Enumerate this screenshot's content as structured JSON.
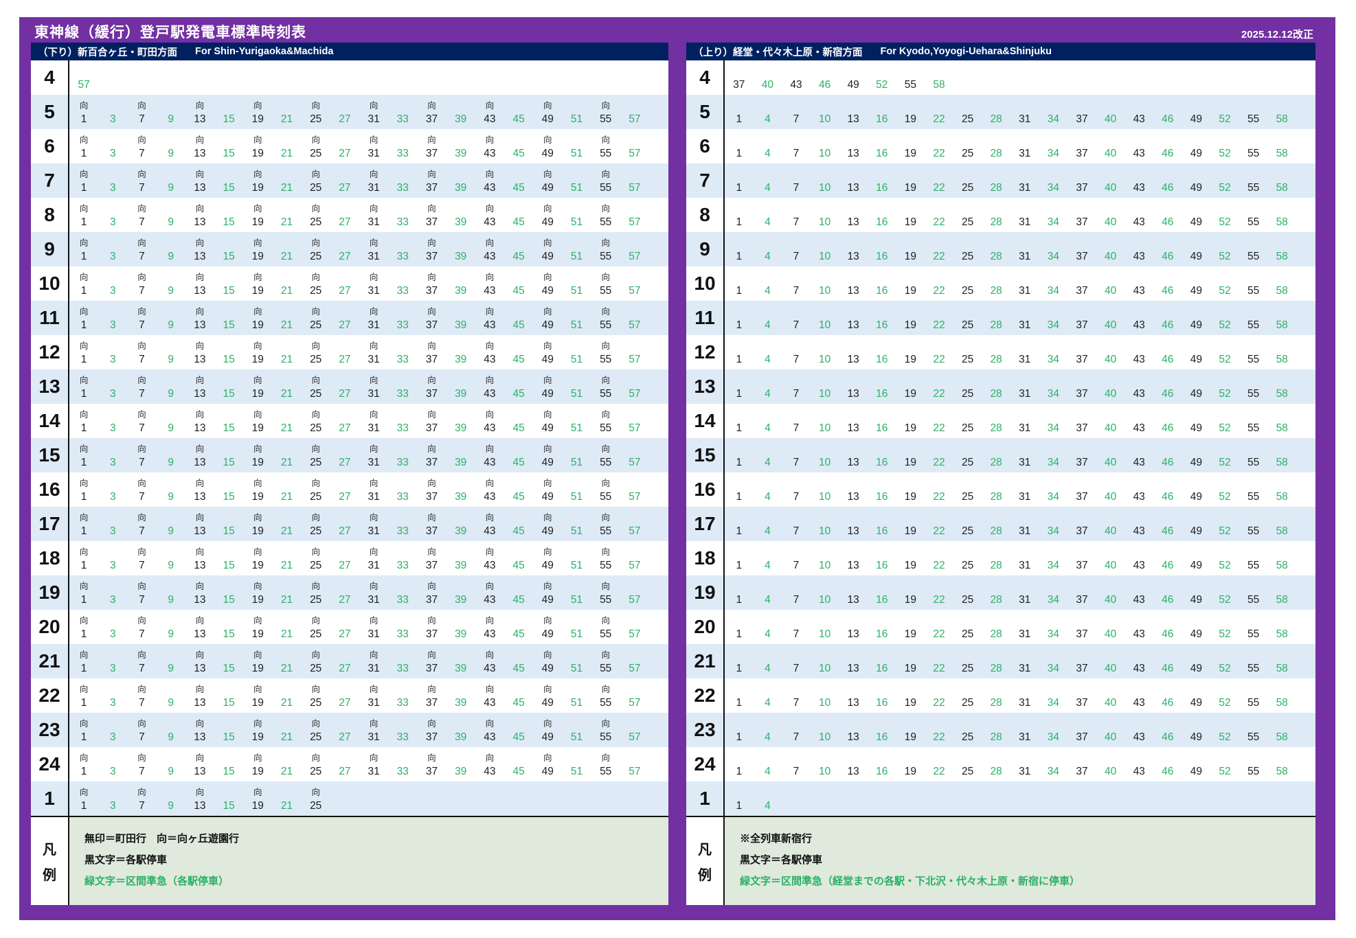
{
  "title": "東神線（緩行）登戸駅発電車標準時刻表",
  "revision": "2025.12.12改正",
  "colors": {
    "accent_purple": "#7230A3",
    "header_navy": "#002060",
    "row_alt_blue": "#DEEAF6",
    "legend_bg_green": "#DFE9DC",
    "semi_express_green": "#2BB166"
  },
  "marker_glyph": "向",
  "panels": [
    {
      "name": "down",
      "header_jp": "（下り）新百合ヶ丘・町田方面",
      "header_en": "For Shin-Yurigaoka&Machida",
      "legend_title": "凡例",
      "legend_lines": [
        {
          "text": "無印＝町田行　向＝向ヶ丘遊園行",
          "green": false
        },
        {
          "text": "黒文字＝各駅停車",
          "green": false
        },
        {
          "text": "緑文字＝区間準急（各駅停車）",
          "green": true
        }
      ],
      "rows": [
        {
          "hour": "4",
          "minutes": [
            "57g"
          ]
        },
        {
          "hour": "5",
          "minutes": [
            "1v",
            "3g",
            "7v",
            "9g",
            "13v",
            "15g",
            "19v",
            "21g",
            "25v",
            "27g",
            "31v",
            "33g",
            "37v",
            "39g",
            "43v",
            "45g",
            "49v",
            "51g",
            "55v",
            "57g"
          ]
        },
        {
          "hour": "6",
          "minutes": [
            "1v",
            "3g",
            "7v",
            "9g",
            "13v",
            "15g",
            "19v",
            "21g",
            "25v",
            "27g",
            "31v",
            "33g",
            "37v",
            "39g",
            "43v",
            "45g",
            "49v",
            "51g",
            "55v",
            "57g"
          ]
        },
        {
          "hour": "7",
          "minutes": [
            "1v",
            "3g",
            "7v",
            "9g",
            "13v",
            "15g",
            "19v",
            "21g",
            "25v",
            "27g",
            "31v",
            "33g",
            "37v",
            "39g",
            "43v",
            "45g",
            "49v",
            "51g",
            "55v",
            "57g"
          ]
        },
        {
          "hour": "8",
          "minutes": [
            "1v",
            "3g",
            "7v",
            "9g",
            "13v",
            "15g",
            "19v",
            "21g",
            "25v",
            "27g",
            "31v",
            "33g",
            "37v",
            "39g",
            "43v",
            "45g",
            "49v",
            "51g",
            "55v",
            "57g"
          ]
        },
        {
          "hour": "9",
          "minutes": [
            "1v",
            "3g",
            "7v",
            "9g",
            "13v",
            "15g",
            "19v",
            "21g",
            "25v",
            "27g",
            "31v",
            "33g",
            "37v",
            "39g",
            "43v",
            "45g",
            "49v",
            "51g",
            "55v",
            "57g"
          ]
        },
        {
          "hour": "10",
          "minutes": [
            "1v",
            "3g",
            "7v",
            "9g",
            "13v",
            "15g",
            "19v",
            "21g",
            "25v",
            "27g",
            "31v",
            "33g",
            "37v",
            "39g",
            "43v",
            "45g",
            "49v",
            "51g",
            "55v",
            "57g"
          ]
        },
        {
          "hour": "11",
          "minutes": [
            "1v",
            "3g",
            "7v",
            "9g",
            "13v",
            "15g",
            "19v",
            "21g",
            "25v",
            "27g",
            "31v",
            "33g",
            "37v",
            "39g",
            "43v",
            "45g",
            "49v",
            "51g",
            "55v",
            "57g"
          ]
        },
        {
          "hour": "12",
          "minutes": [
            "1v",
            "3g",
            "7v",
            "9g",
            "13v",
            "15g",
            "19v",
            "21g",
            "25v",
            "27g",
            "31v",
            "33g",
            "37v",
            "39g",
            "43v",
            "45g",
            "49v",
            "51g",
            "55v",
            "57g"
          ]
        },
        {
          "hour": "13",
          "minutes": [
            "1v",
            "3g",
            "7v",
            "9g",
            "13v",
            "15g",
            "19v",
            "21g",
            "25v",
            "27g",
            "31v",
            "33g",
            "37v",
            "39g",
            "43v",
            "45g",
            "49v",
            "51g",
            "55v",
            "57g"
          ]
        },
        {
          "hour": "14",
          "minutes": [
            "1v",
            "3g",
            "7v",
            "9g",
            "13v",
            "15g",
            "19v",
            "21g",
            "25v",
            "27g",
            "31v",
            "33g",
            "37v",
            "39g",
            "43v",
            "45g",
            "49v",
            "51g",
            "55v",
            "57g"
          ]
        },
        {
          "hour": "15",
          "minutes": [
            "1v",
            "3g",
            "7v",
            "9g",
            "13v",
            "15g",
            "19v",
            "21g",
            "25v",
            "27g",
            "31v",
            "33g",
            "37v",
            "39g",
            "43v",
            "45g",
            "49v",
            "51g",
            "55v",
            "57g"
          ]
        },
        {
          "hour": "16",
          "minutes": [
            "1v",
            "3g",
            "7v",
            "9g",
            "13v",
            "15g",
            "19v",
            "21g",
            "25v",
            "27g",
            "31v",
            "33g",
            "37v",
            "39g",
            "43v",
            "45g",
            "49v",
            "51g",
            "55v",
            "57g"
          ]
        },
        {
          "hour": "17",
          "minutes": [
            "1v",
            "3g",
            "7v",
            "9g",
            "13v",
            "15g",
            "19v",
            "21g",
            "25v",
            "27g",
            "31v",
            "33g",
            "37v",
            "39g",
            "43v",
            "45g",
            "49v",
            "51g",
            "55v",
            "57g"
          ]
        },
        {
          "hour": "18",
          "minutes": [
            "1v",
            "3g",
            "7v",
            "9g",
            "13v",
            "15g",
            "19v",
            "21g",
            "25v",
            "27g",
            "31v",
            "33g",
            "37v",
            "39g",
            "43v",
            "45g",
            "49v",
            "51g",
            "55v",
            "57g"
          ]
        },
        {
          "hour": "19",
          "minutes": [
            "1v",
            "3g",
            "7v",
            "9g",
            "13v",
            "15g",
            "19v",
            "21g",
            "25v",
            "27g",
            "31v",
            "33g",
            "37v",
            "39g",
            "43v",
            "45g",
            "49v",
            "51g",
            "55v",
            "57g"
          ]
        },
        {
          "hour": "20",
          "minutes": [
            "1v",
            "3g",
            "7v",
            "9g",
            "13v",
            "15g",
            "19v",
            "21g",
            "25v",
            "27g",
            "31v",
            "33g",
            "37v",
            "39g",
            "43v",
            "45g",
            "49v",
            "51g",
            "55v",
            "57g"
          ]
        },
        {
          "hour": "21",
          "minutes": [
            "1v",
            "3g",
            "7v",
            "9g",
            "13v",
            "15g",
            "19v",
            "21g",
            "25v",
            "27g",
            "31v",
            "33g",
            "37v",
            "39g",
            "43v",
            "45g",
            "49v",
            "51g",
            "55v",
            "57g"
          ]
        },
        {
          "hour": "22",
          "minutes": [
            "1v",
            "3g",
            "7v",
            "9g",
            "13v",
            "15g",
            "19v",
            "21g",
            "25v",
            "27g",
            "31v",
            "33g",
            "37v",
            "39g",
            "43v",
            "45g",
            "49v",
            "51g",
            "55v",
            "57g"
          ]
        },
        {
          "hour": "23",
          "minutes": [
            "1v",
            "3g",
            "7v",
            "9g",
            "13v",
            "15g",
            "19v",
            "21g",
            "25v",
            "27g",
            "31v",
            "33g",
            "37v",
            "39g",
            "43v",
            "45g",
            "49v",
            "51g",
            "55v",
            "57g"
          ]
        },
        {
          "hour": "24",
          "minutes": [
            "1v",
            "3g",
            "7v",
            "9g",
            "13v",
            "15g",
            "19v",
            "21g",
            "25v",
            "27g",
            "31v",
            "33g",
            "37v",
            "39g",
            "43v",
            "45g",
            "49v",
            "51g",
            "55v",
            "57g"
          ]
        },
        {
          "hour": "1",
          "minutes": [
            "1v",
            "3g",
            "7v",
            "9g",
            "13v",
            "15g",
            "19v",
            "21g",
            "25v"
          ]
        }
      ]
    },
    {
      "name": "up",
      "header_jp": "（上り）経堂・代々木上原・新宿方面",
      "header_en": "For Kyodo,Yoyogi-Uehara&Shinjuku",
      "legend_title": "凡例",
      "legend_lines": [
        {
          "text": "※全列車新宿行",
          "green": false
        },
        {
          "text": "黒文字＝各駅停車",
          "green": false
        },
        {
          "text": "緑文字＝区間準急（経堂までの各駅・下北沢・代々木上原・新宿に停車）",
          "green": true
        }
      ],
      "rows": [
        {
          "hour": "4",
          "minutes": [
            "37",
            "40g",
            "43",
            "46g",
            "49",
            "52g",
            "55",
            "58g"
          ]
        },
        {
          "hour": "5",
          "minutes": [
            "1",
            "4g",
            "7",
            "10g",
            "13",
            "16g",
            "19",
            "22g",
            "25",
            "28g",
            "31",
            "34g",
            "37",
            "40g",
            "43",
            "46g",
            "49",
            "52g",
            "55",
            "58g"
          ]
        },
        {
          "hour": "6",
          "minutes": [
            "1",
            "4g",
            "7",
            "10g",
            "13",
            "16g",
            "19",
            "22g",
            "25",
            "28g",
            "31",
            "34g",
            "37",
            "40g",
            "43",
            "46g",
            "49",
            "52g",
            "55",
            "58g"
          ]
        },
        {
          "hour": "7",
          "minutes": [
            "1",
            "4g",
            "7",
            "10g",
            "13",
            "16g",
            "19",
            "22g",
            "25",
            "28g",
            "31",
            "34g",
            "37",
            "40g",
            "43",
            "46g",
            "49",
            "52g",
            "55",
            "58g"
          ]
        },
        {
          "hour": "8",
          "minutes": [
            "1",
            "4g",
            "7",
            "10g",
            "13",
            "16g",
            "19",
            "22g",
            "25",
            "28g",
            "31",
            "34g",
            "37",
            "40g",
            "43",
            "46g",
            "49",
            "52g",
            "55",
            "58g"
          ]
        },
        {
          "hour": "9",
          "minutes": [
            "1",
            "4g",
            "7",
            "10g",
            "13",
            "16g",
            "19",
            "22g",
            "25",
            "28g",
            "31",
            "34g",
            "37",
            "40g",
            "43",
            "46g",
            "49",
            "52g",
            "55",
            "58g"
          ]
        },
        {
          "hour": "10",
          "minutes": [
            "1",
            "4g",
            "7",
            "10g",
            "13",
            "16g",
            "19",
            "22g",
            "25",
            "28g",
            "31",
            "34g",
            "37",
            "40g",
            "43",
            "46g",
            "49",
            "52g",
            "55",
            "58g"
          ]
        },
        {
          "hour": "11",
          "minutes": [
            "1",
            "4g",
            "7",
            "10g",
            "13",
            "16g",
            "19",
            "22g",
            "25",
            "28g",
            "31",
            "34g",
            "37",
            "40g",
            "43",
            "46g",
            "49",
            "52g",
            "55",
            "58g"
          ]
        },
        {
          "hour": "12",
          "minutes": [
            "1",
            "4g",
            "7",
            "10g",
            "13",
            "16g",
            "19",
            "22g",
            "25",
            "28g",
            "31",
            "34g",
            "37",
            "40g",
            "43",
            "46g",
            "49",
            "52g",
            "55",
            "58g"
          ]
        },
        {
          "hour": "13",
          "minutes": [
            "1",
            "4g",
            "7",
            "10g",
            "13",
            "16g",
            "19",
            "22g",
            "25",
            "28g",
            "31",
            "34g",
            "37",
            "40g",
            "43",
            "46g",
            "49",
            "52g",
            "55",
            "58g"
          ]
        },
        {
          "hour": "14",
          "minutes": [
            "1",
            "4g",
            "7",
            "10g",
            "13",
            "16g",
            "19",
            "22g",
            "25",
            "28g",
            "31",
            "34g",
            "37",
            "40g",
            "43",
            "46g",
            "49",
            "52g",
            "55",
            "58g"
          ]
        },
        {
          "hour": "15",
          "minutes": [
            "1",
            "4g",
            "7",
            "10g",
            "13",
            "16g",
            "19",
            "22g",
            "25",
            "28g",
            "31",
            "34g",
            "37",
            "40g",
            "43",
            "46g",
            "49",
            "52g",
            "55",
            "58g"
          ]
        },
        {
          "hour": "16",
          "minutes": [
            "1",
            "4g",
            "7",
            "10g",
            "13",
            "16g",
            "19",
            "22g",
            "25",
            "28g",
            "31",
            "34g",
            "37",
            "40g",
            "43",
            "46g",
            "49",
            "52g",
            "55",
            "58g"
          ]
        },
        {
          "hour": "17",
          "minutes": [
            "1",
            "4g",
            "7",
            "10g",
            "13",
            "16g",
            "19",
            "22g",
            "25",
            "28g",
            "31",
            "34g",
            "37",
            "40g",
            "43",
            "46g",
            "49",
            "52g",
            "55",
            "58g"
          ]
        },
        {
          "hour": "18",
          "minutes": [
            "1",
            "4g",
            "7",
            "10g",
            "13",
            "16g",
            "19",
            "22g",
            "25",
            "28g",
            "31",
            "34g",
            "37",
            "40g",
            "43",
            "46g",
            "49",
            "52g",
            "55",
            "58g"
          ]
        },
        {
          "hour": "19",
          "minutes": [
            "1",
            "4g",
            "7",
            "10g",
            "13",
            "16g",
            "19",
            "22g",
            "25",
            "28g",
            "31",
            "34g",
            "37",
            "40g",
            "43",
            "46g",
            "49",
            "52g",
            "55",
            "58g"
          ]
        },
        {
          "hour": "20",
          "minutes": [
            "1",
            "4g",
            "7",
            "10g",
            "13",
            "16g",
            "19",
            "22g",
            "25",
            "28g",
            "31",
            "34g",
            "37",
            "40g",
            "43",
            "46g",
            "49",
            "52g",
            "55",
            "58g"
          ]
        },
        {
          "hour": "21",
          "minutes": [
            "1",
            "4g",
            "7",
            "10g",
            "13",
            "16g",
            "19",
            "22g",
            "25",
            "28g",
            "31",
            "34g",
            "37",
            "40g",
            "43",
            "46g",
            "49",
            "52g",
            "55",
            "58g"
          ]
        },
        {
          "hour": "22",
          "minutes": [
            "1",
            "4g",
            "7",
            "10g",
            "13",
            "16g",
            "19",
            "22g",
            "25",
            "28g",
            "31",
            "34g",
            "37",
            "40g",
            "43",
            "46g",
            "49",
            "52g",
            "55",
            "58g"
          ]
        },
        {
          "hour": "23",
          "minutes": [
            "1",
            "4g",
            "7",
            "10g",
            "13",
            "16g",
            "19",
            "22g",
            "25",
            "28g",
            "31",
            "34g",
            "37",
            "40g",
            "43",
            "46g",
            "49",
            "52g",
            "55",
            "58g"
          ]
        },
        {
          "hour": "24",
          "minutes": [
            "1",
            "4g",
            "7",
            "10g",
            "13",
            "16g",
            "19",
            "22g",
            "25",
            "28g",
            "31",
            "34g",
            "37",
            "40g",
            "43",
            "46g",
            "49",
            "52g",
            "55",
            "58g"
          ]
        },
        {
          "hour": "1",
          "minutes": [
            "1",
            "4g"
          ]
        }
      ]
    }
  ]
}
